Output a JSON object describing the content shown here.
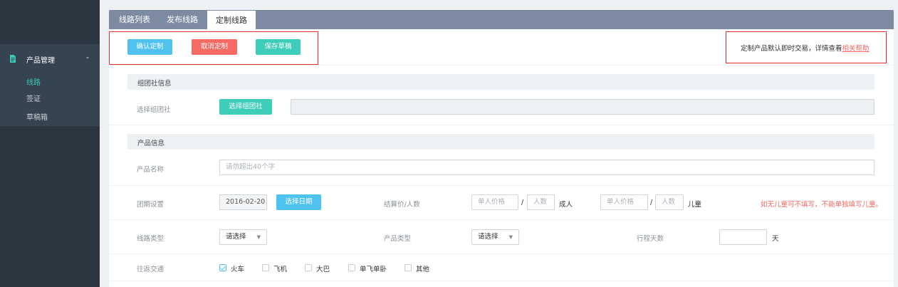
{
  "sidebar": {
    "group_label": "产品管理",
    "collapse_symbol": "-",
    "items": [
      {
        "label": "线路"
      },
      {
        "label": "签证"
      },
      {
        "label": "草稿箱"
      }
    ]
  },
  "tabs": [
    {
      "label": "线路列表"
    },
    {
      "label": "发布线路"
    },
    {
      "label": "定制线路"
    }
  ],
  "toolbar": {
    "confirm_label": "确认定制",
    "cancel_label": "取消定制",
    "save_label": "保存草稿"
  },
  "help": {
    "text": "定制产品默认即时交易，详情查看",
    "link": "相关帮助"
  },
  "group_section": {
    "title": "组团社信息",
    "select_label": "选择组团社",
    "select_button": "选择组团社",
    "value": ""
  },
  "product_section": {
    "title": "产品信息",
    "name_label": "产品名称",
    "name_placeholder": "请勿超出40个字",
    "period_label": "团期设置",
    "period_value": "2016-02-20",
    "period_button": "选择日期",
    "price_label": "结算价/人数",
    "price_placeholder": "单人价格",
    "count_placeholder": "人数",
    "slash": "/",
    "adult": "成人",
    "child": "儿童",
    "child_note": "如无儿童可不填写，不能单独填写儿童。",
    "route_type_label": "线路类型",
    "route_type_value": "请选择",
    "product_type_label": "产品类型",
    "product_type_value": "请选择",
    "days_label": "行程天数",
    "days_value": "",
    "days_unit": "天",
    "transport_label": "往返交通",
    "transport_options": [
      {
        "label": "火车",
        "checked": true
      },
      {
        "label": "飞机",
        "checked": false
      },
      {
        "label": "大巴",
        "checked": false
      },
      {
        "label": "单飞单卧",
        "checked": false
      },
      {
        "label": "其他",
        "checked": false
      }
    ]
  },
  "colors": {
    "sidebar": "#2c3641",
    "sidebar_group": "#364350",
    "active_item": "#3ec9b7",
    "tabbar": "#7d8ba2",
    "btn_blue": "#4fc2f0",
    "btn_red": "#f56a62",
    "btn_teal": "#3ecdb8",
    "highlight_box": "#e52b2b"
  }
}
